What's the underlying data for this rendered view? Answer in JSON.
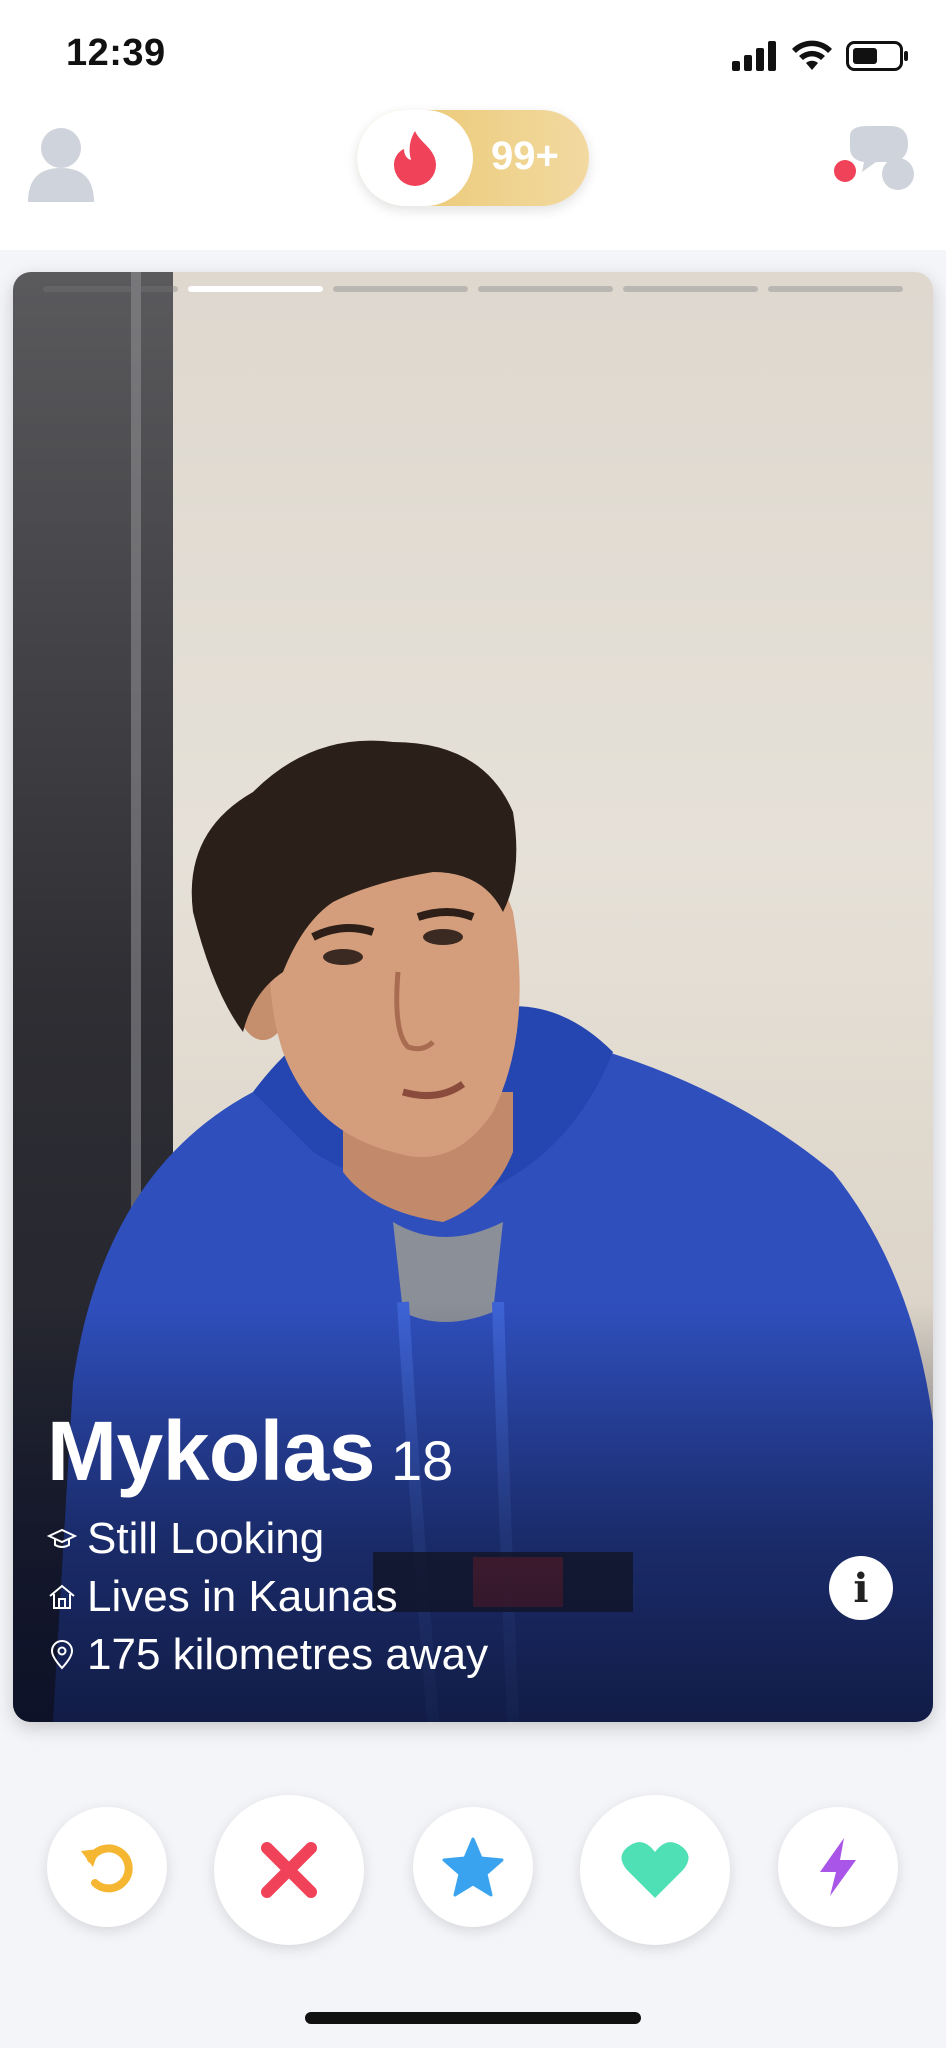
{
  "status_bar": {
    "time": "12:39"
  },
  "top_bar": {
    "boost_count": "99+"
  },
  "card": {
    "photo_count": 6,
    "active_photo_index": 1,
    "name": "Mykolas",
    "age": "18",
    "details": [
      {
        "icon": "graduation-cap-icon",
        "text": "Still Looking"
      },
      {
        "icon": "home-icon",
        "text": "Lives in Kaunas"
      },
      {
        "icon": "location-pin-icon",
        "text": "175 kilometres away"
      }
    ],
    "info_label": "i"
  },
  "actions": [
    {
      "name": "rewind-button",
      "icon": "rewind-icon",
      "color": "#f5b731"
    },
    {
      "name": "nope-button",
      "icon": "close-icon",
      "color": "#f0435a"
    },
    {
      "name": "super-like-button",
      "icon": "star-icon",
      "color": "#3aa3f0"
    },
    {
      "name": "like-button",
      "icon": "heart-icon",
      "color": "#4fe0b5"
    },
    {
      "name": "boost-button",
      "icon": "lightning-icon",
      "color": "#a855e8"
    }
  ]
}
